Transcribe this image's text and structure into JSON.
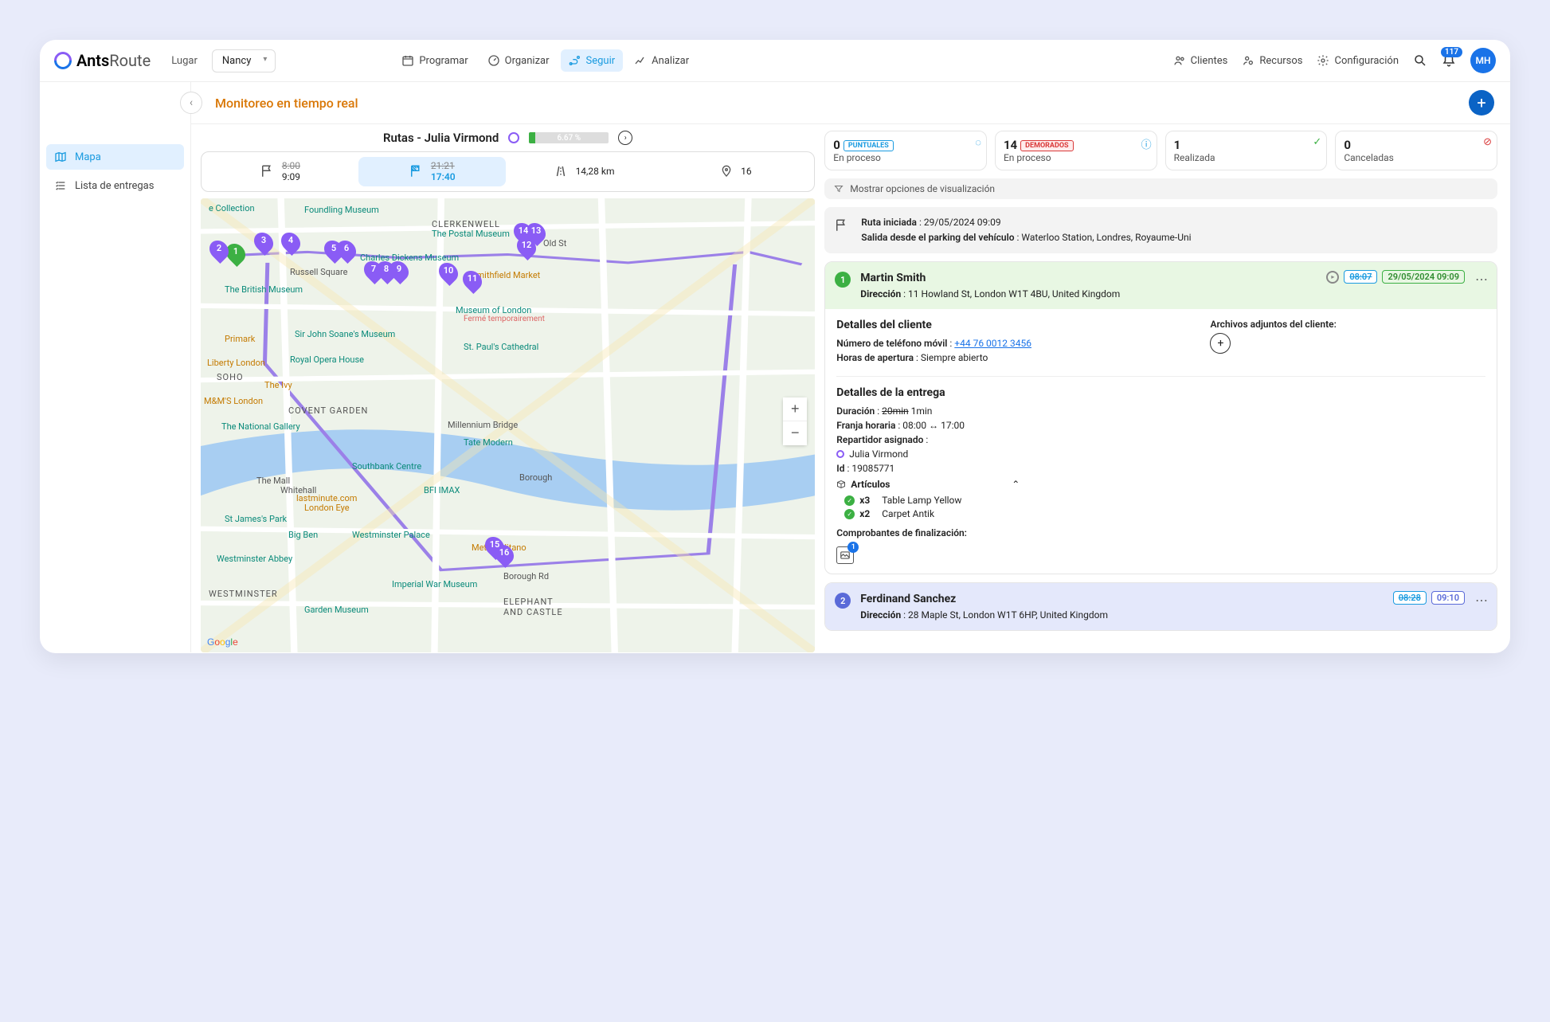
{
  "header": {
    "logo": {
      "brand": "Ants",
      "suffix": "Route"
    },
    "location_label": "Lugar",
    "location_value": "Nancy",
    "nav": {
      "schedule": "Programar",
      "organize": "Organizar",
      "follow": "Seguir",
      "analyze": "Analizar"
    },
    "right": {
      "clients": "Clientes",
      "resources": "Recursos",
      "config": "Configuración",
      "notif_count": "117",
      "avatar": "MH"
    }
  },
  "sidebar": {
    "map": "Mapa",
    "list": "Lista de entregas"
  },
  "page": {
    "title": "Monitoreo en tiempo real",
    "route_name": "Rutas - Julia Virmond",
    "progress_pct": "6.67 %"
  },
  "route_bar": {
    "start_strike": "8:00",
    "start_actual": "9:09",
    "end_strike": "21:21",
    "end_actual": "17:40",
    "distance": "14,28 km",
    "stops": "16"
  },
  "stats": {
    "punctual_n": "0",
    "punctual_chip": "PUNTUALES",
    "punctual_l": "En proceso",
    "delayed_n": "14",
    "delayed_chip": "DEMORADOS",
    "delayed_l": "En proceso",
    "done_n": "1",
    "done_l": "Realizada",
    "cancel_n": "0",
    "cancel_l": "Canceladas"
  },
  "display_options": "Mostrar opciones de visualización",
  "route_start": {
    "line1_label": "Ruta iniciada",
    "line1_value": "29/05/2024 09:09",
    "line2_label": "Salida desde el parking del vehículo",
    "line2_value": "Waterloo Station, Londres, Royaume-Uni"
  },
  "stop1": {
    "name": "Martin Smith",
    "addr_label": "Dirección",
    "addr": "11 Howland St, London W1T 4BU, United Kingdom",
    "time_old": "08:07",
    "time_new": "29/05/2024 09:09",
    "client_h": "Detalles del cliente",
    "phone_label": "Número de teléfono móvil",
    "phone": "+44 76 0012 3456",
    "hours_label": "Horas de apertura",
    "hours": "Siempre abierto",
    "attach_label": "Archivos adjuntos del cliente:",
    "delivery_h": "Detalles de la entrega",
    "dur_label": "Duración",
    "dur_strike": "20min",
    "dur_val": "1min",
    "slot_label": "Franja horaria",
    "slot": "08:00 ↔ 17:00",
    "driver_label": "Repartidor asignado",
    "driver": "Julia Virmond",
    "id_label": "Id",
    "id": "19085771",
    "articles_label": "Artículos",
    "art1_qty": "x3",
    "art1_name": "Table Lamp Yellow",
    "art2_qty": "x2",
    "art2_name": "Carpet Antik",
    "proof_label": "Comprobantes de finalización:",
    "proof_count": "1"
  },
  "stop2": {
    "name": "Ferdinand Sanchez",
    "addr_label": "Dirección",
    "addr": "28 Maple St, London W1T 6HP, United Kingdom",
    "time_old": "08:28",
    "time_new": "09:10"
  },
  "map_labels": {
    "clerkenwell": "CLERKENWELL",
    "soho": "SOHO",
    "coventgarden": "COVENT GARDEN",
    "westminster": "WESTMINSTER",
    "foundling": "Foundling Museum",
    "postal": "The Postal Museum",
    "dickens": "Charles Dickens Museum",
    "russell": "Russell Square",
    "britmus": "The British Museum",
    "soane": "Sir John Soane's Museum",
    "stpaul": "St. Paul's Cathedral",
    "muslondon": "Museum of London",
    "muslondon2": "Fermé temporairement",
    "liberty": "Liberty London",
    "opera": "Royal Opera House",
    "ivy": "The Ivy",
    "mms": "M&M'S London",
    "natgal": "The National Gallery",
    "millbridge": "Millennium Bridge",
    "tatemod": "Tate Modern",
    "southbank": "Southbank Centre",
    "bfi": "BFI IMAX",
    "borough": "Borough",
    "borough2": "Borough Rd",
    "lastmin": "lastminute.com",
    "londoneye": "London Eye",
    "whitehall": "Whitehall",
    "stjames": "St James's Park",
    "bigben": "Big Ben",
    "westpal": "Westminster Palace",
    "westabbey": "Westminster Abbey",
    "smithfield": "Smithfield Market",
    "impwar": "Imperial War Museum",
    "garden": "Garden Museum",
    "elephant": "ELEPHANT\nAND CASTLE",
    "metro": "Metropolitano",
    "themall": "The Mall",
    "collection": "e Collection",
    "primark": "Primark",
    "oldst": "Old St"
  }
}
